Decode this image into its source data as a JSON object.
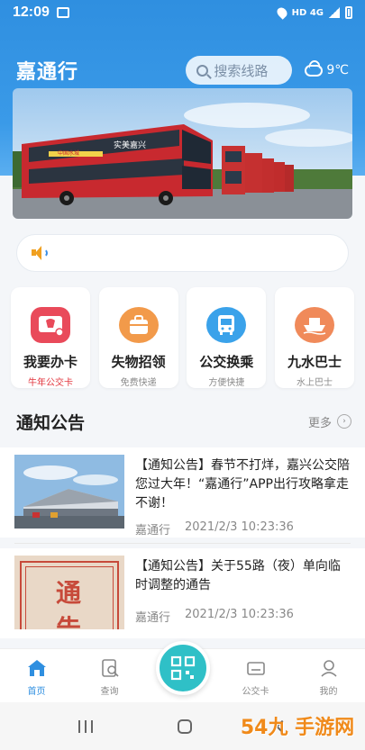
{
  "status_bar": {
    "time": "12:09",
    "indicators": "HD 4G"
  },
  "header": {
    "title": "嘉通行",
    "search_placeholder": "搜索线路",
    "weather": {
      "temp": "9℃",
      "icon": "cloud-icon"
    }
  },
  "banner": {
    "bus_slogan": "实美嘉兴",
    "bus_text_left": "中国水城"
  },
  "notice_bar": {
    "icon": "speaker-icon",
    "text": ""
  },
  "services": [
    {
      "title": "我要办卡",
      "subtitle": "牛年公交卡",
      "icon": "card-icon",
      "color": "#e94a5a"
    },
    {
      "title": "失物招领",
      "subtitle": "免费快递",
      "icon": "bag-icon",
      "color": "#f29a4a"
    },
    {
      "title": "公交换乘",
      "subtitle": "方便快捷",
      "icon": "bus-icon",
      "color": "#3aa2ea"
    },
    {
      "title": "九水巴士",
      "subtitle": "水上巴士",
      "icon": "boat-icon",
      "color": "#f08a5a"
    }
  ],
  "announcements": {
    "title": "通知公告",
    "more": "更多",
    "items": [
      {
        "title": "【通知公告】春节不打烊，嘉兴公交陪您过大年！“嘉通行”APP出行攻略拿走不谢！",
        "source": "嘉通行",
        "time": "2021/2/3 10:23:36"
      },
      {
        "title": "【通知公告】关于55路（夜）单向临时调整的通告",
        "source": "嘉通行",
        "time": "2021/2/3 10:23:36",
        "thumb_text": "通告"
      }
    ]
  },
  "bottom_nav": [
    {
      "label": "首页",
      "icon": "home-icon",
      "active": true
    },
    {
      "label": "查询",
      "icon": "search-doc-icon",
      "active": false
    },
    {
      "label": "",
      "icon": "qr-scan-icon",
      "active": false
    },
    {
      "label": "公交卡",
      "icon": "wallet-icon",
      "active": false
    },
    {
      "label": "我的",
      "icon": "user-icon",
      "active": false
    }
  ],
  "watermark": {
    "text": "54九 手游网"
  },
  "colors": {
    "primary": "#2f8fe0",
    "accent_teal": "#2fc0c7",
    "red": "#e2353d"
  }
}
